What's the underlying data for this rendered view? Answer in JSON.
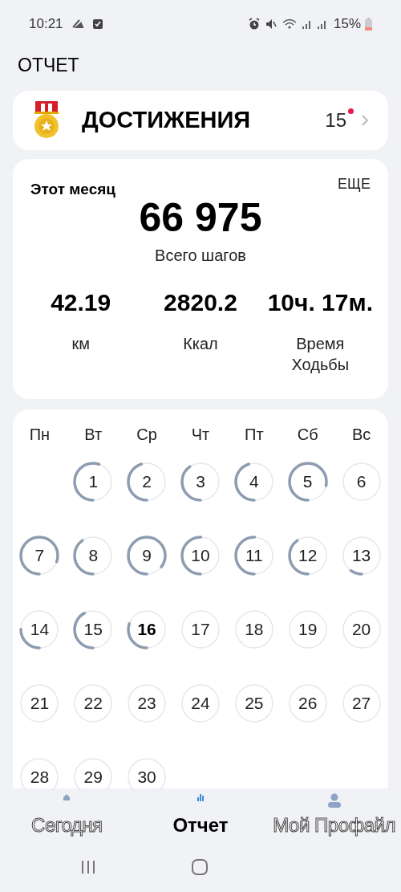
{
  "status_bar": {
    "time": "10:21",
    "battery": "15%"
  },
  "page_title": "ОТЧЕТ",
  "achievements": {
    "label": "ДОСТИЖЕНИЯ",
    "count": "15",
    "new": true
  },
  "month_summary": {
    "period": "Этот месяц",
    "more": "ЕЩЕ",
    "total": "66 975",
    "total_label": "Всего шагов",
    "stats": [
      {
        "value": "42.19",
        "label": "км"
      },
      {
        "value": "2820.2",
        "label": "Ккал"
      },
      {
        "value": "10ч. 17м.",
        "label": "Время Ходьбы"
      }
    ]
  },
  "calendar": {
    "weekdays": [
      "Пн",
      "Вт",
      "Ср",
      "Чт",
      "Пт",
      "Сб",
      "Вс"
    ],
    "days": [
      {
        "label": "1",
        "selected": false
      },
      {
        "label": "2",
        "selected": false
      },
      {
        "label": "3",
        "selected": false
      },
      {
        "label": "4",
        "selected": false
      },
      {
        "label": "5",
        "selected": false
      },
      {
        "label": "6",
        "selected": false
      },
      {
        "label": "7",
        "selected": false
      },
      {
        "label": "8",
        "selected": false
      },
      {
        "label": "9",
        "selected": false
      },
      {
        "label": "10",
        "selected": false
      },
      {
        "label": "11",
        "selected": false
      },
      {
        "label": "12",
        "selected": false
      },
      {
        "label": "13",
        "selected": false
      },
      {
        "label": "14",
        "selected": false
      },
      {
        "label": "15",
        "selected": false
      },
      {
        "label": "16",
        "selected": true
      },
      {
        "label": "17",
        "selected": false
      },
      {
        "label": "18",
        "selected": false
      },
      {
        "label": "19",
        "selected": false
      },
      {
        "label": "20",
        "selected": false
      },
      {
        "label": "21",
        "selected": false
      },
      {
        "label": "22",
        "selected": false
      },
      {
        "label": "23",
        "selected": false
      },
      {
        "label": "24",
        "selected": false
      },
      {
        "label": "25",
        "selected": false
      },
      {
        "label": "26",
        "selected": false
      },
      {
        "label": "27",
        "selected": false
      },
      {
        "label": "28",
        "selected": false
      },
      {
        "label": "29",
        "selected": false
      },
      {
        "label": "30",
        "selected": false
      }
    ]
  },
  "bottom_nav": [
    {
      "kind": "home",
      "label": "Сегодня",
      "selected": false
    },
    {
      "kind": "report",
      "label": "Отчет",
      "selected": true
    },
    {
      "kind": "profile",
      "label": "Мой Профайл",
      "selected": false
    }
  ]
}
